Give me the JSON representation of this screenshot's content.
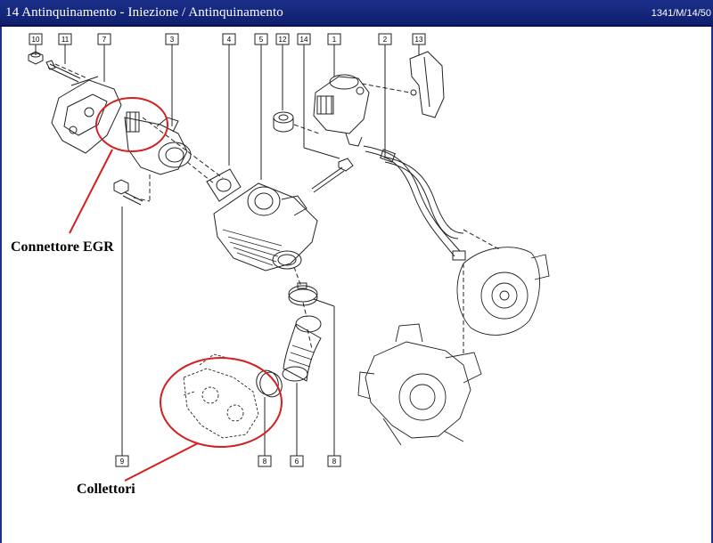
{
  "window": {
    "title": "14 Antinquinamento - Iniezione / Antinquinamento",
    "ref": "1341/M/14/50"
  },
  "callouts": {
    "egr": "Connettore EGR",
    "manifolds": "Collettori"
  },
  "part_tags": [
    "10",
    "11",
    "7",
    "3",
    "4",
    "5",
    "12",
    "14",
    "1",
    "2",
    "13",
    "9",
    "8",
    "6",
    "8"
  ],
  "colors": {
    "titlebar": "#1b2f8a",
    "highlight": "#d42020",
    "line": "#222222"
  }
}
